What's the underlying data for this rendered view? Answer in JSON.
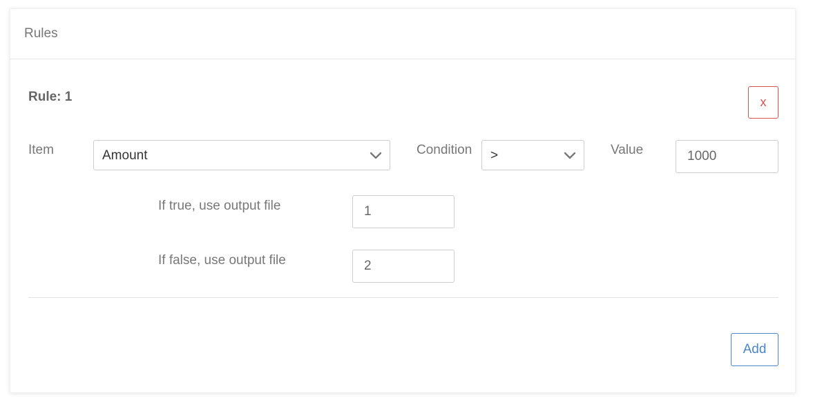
{
  "panel": {
    "title": "Rules"
  },
  "rule": {
    "title": "Rule: 1",
    "remove_label": "x",
    "item": {
      "label": "Item",
      "value": "Amount"
    },
    "condition": {
      "label": "Condition",
      "value": ">"
    },
    "value": {
      "label": "Value",
      "value": "1000"
    },
    "true_output": {
      "label": "If true, use output file",
      "value": "1"
    },
    "false_output": {
      "label": "If false, use output file",
      "value": "2"
    }
  },
  "actions": {
    "add_label": "Add"
  },
  "colors": {
    "remove": "#d9534f",
    "add": "#4a86c8",
    "border": "#cccccc"
  },
  "icons": {
    "dropdown": "chevron-down-icon"
  }
}
